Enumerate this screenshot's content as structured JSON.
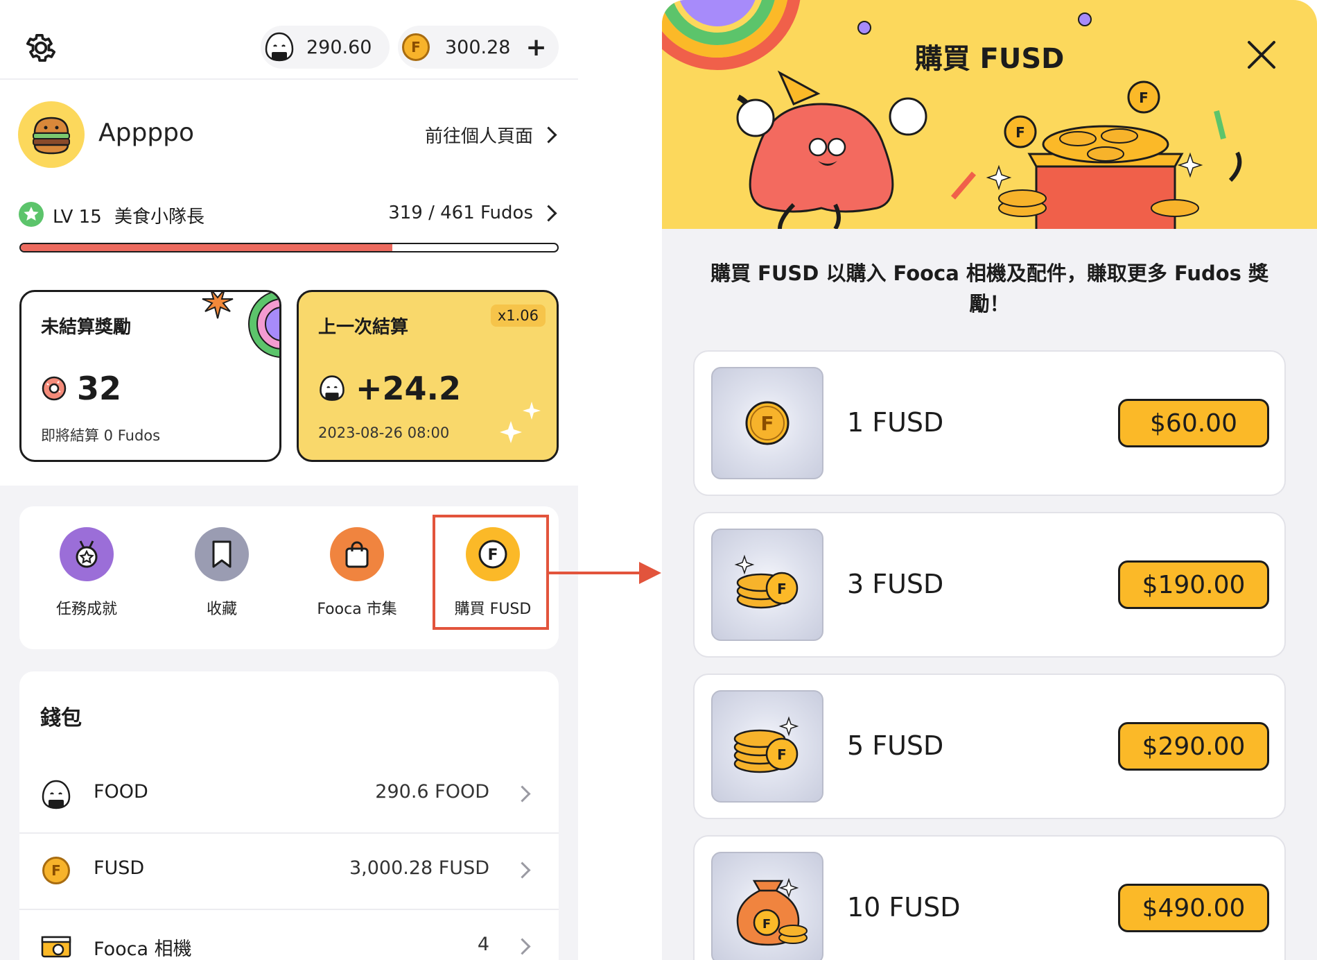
{
  "left": {
    "balances": {
      "food": "290.60",
      "fusd": "300.28",
      "add": "+"
    },
    "profile": {
      "name": "Appppo",
      "link": "前往個人頁面"
    },
    "level": {
      "label": "LV 15",
      "title": "美食小隊長",
      "progress_text": "319 / 461 Fudos",
      "progress": 0.692
    },
    "card_pending": {
      "title": "未結算獎勵",
      "value": "32",
      "sub": "即將結算 0 Fudos"
    },
    "card_last": {
      "title": "上一次結算",
      "badge": "x1.06",
      "value": "+24.2",
      "time": "2023-08-26 08:00"
    },
    "actions": [
      {
        "label": "任務成就",
        "icon": "medal-icon"
      },
      {
        "label": "收藏",
        "icon": "bookmark-icon"
      },
      {
        "label": "Fooca 市集",
        "icon": "shopping-bag-icon"
      },
      {
        "label": "購買 FUSD",
        "icon": "fusd-coin-icon"
      }
    ],
    "wallet": {
      "title": "錢包",
      "rows": [
        {
          "label": "FOOD",
          "value": "290.6 FOOD"
        },
        {
          "label": "FUSD",
          "value": "3,000.28 FUSD"
        },
        {
          "label": "Fooca 相機",
          "value": "4"
        }
      ]
    }
  },
  "right": {
    "title": "購買 FUSD",
    "description": "購買 FUSD 以購入 Fooca 相機及配件，賺取更多 Fudos 獎勵！",
    "options": [
      {
        "name": "1 FUSD",
        "price": "$60.00"
      },
      {
        "name": "3 FUSD",
        "price": "$190.00"
      },
      {
        "name": "5 FUSD",
        "price": "$290.00"
      },
      {
        "name": "10 FUSD",
        "price": "$490.00"
      }
    ]
  },
  "colors": {
    "accent": "#fbb928",
    "hero_bg": "#fcd85c",
    "progress": "#ec6a5e",
    "highlight": "#e2543c",
    "card_yellow": "#f9d86b"
  }
}
